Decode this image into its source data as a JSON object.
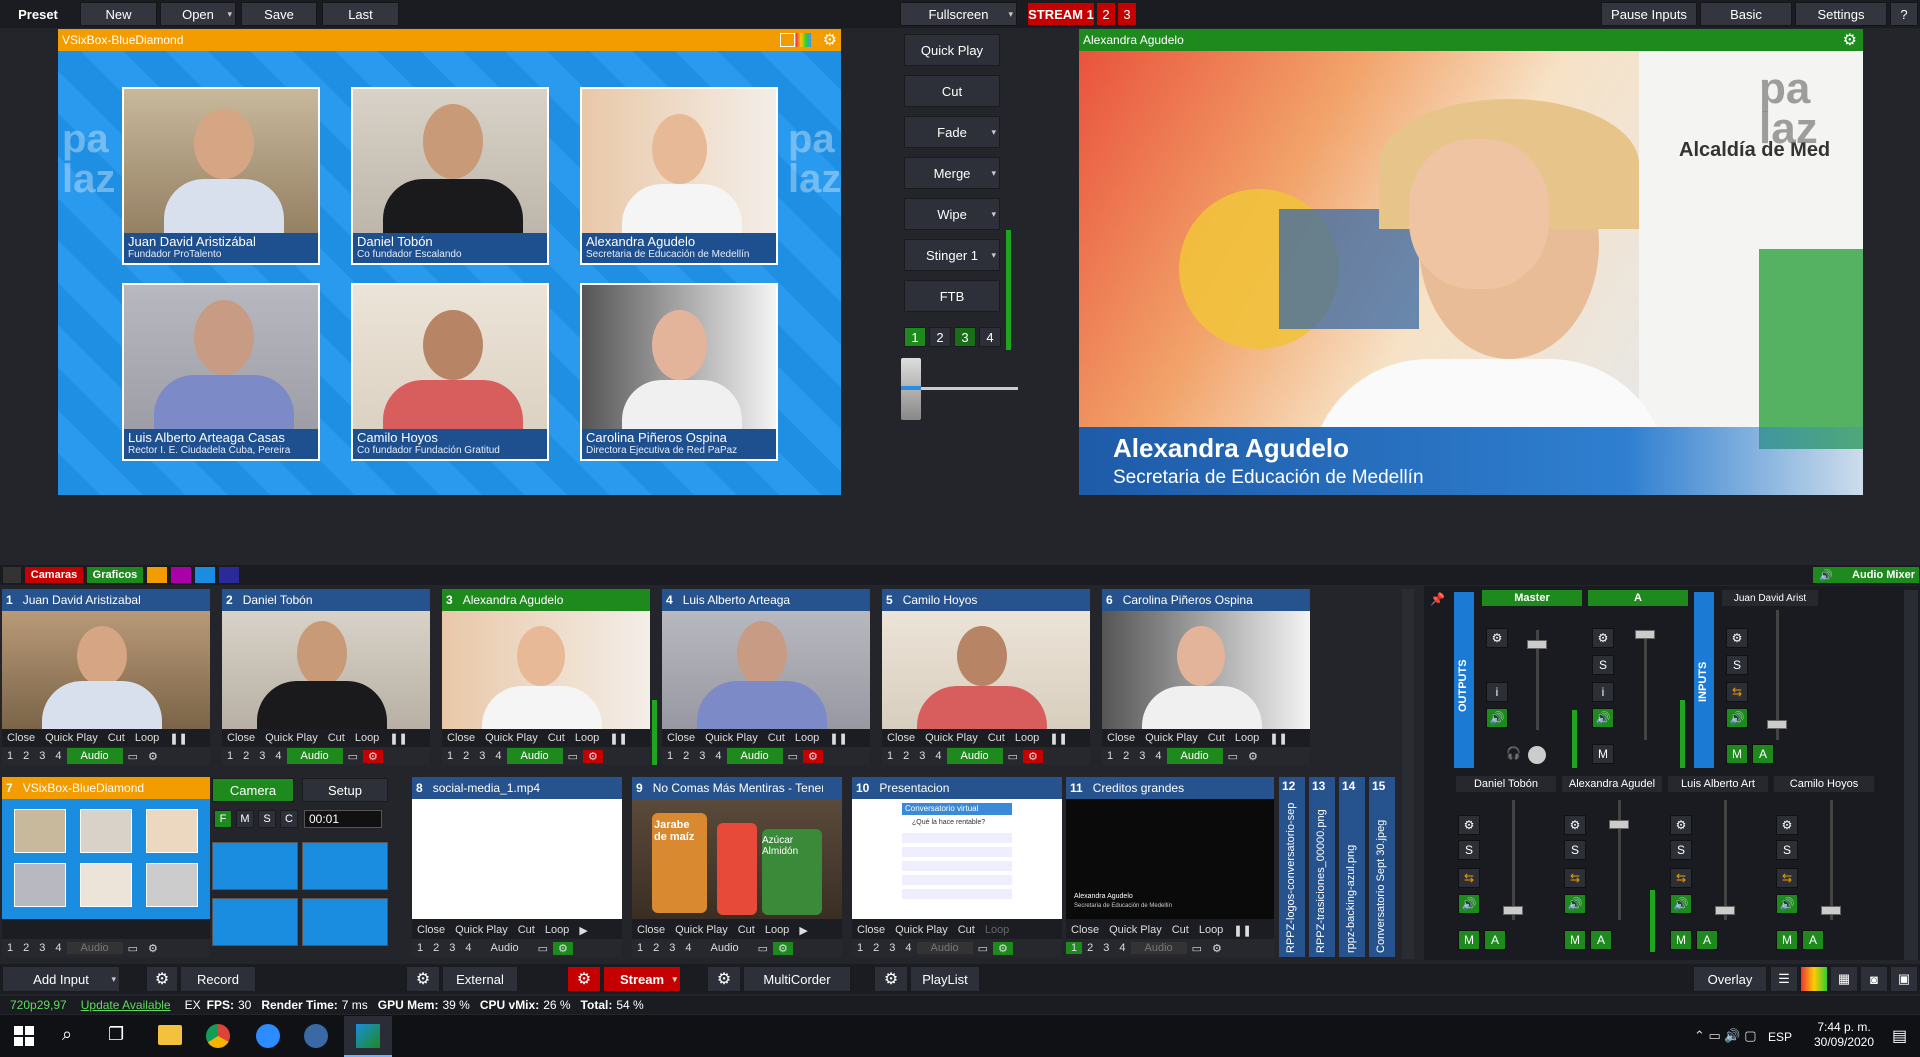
{
  "topbar": {
    "preset": "Preset",
    "new": "New",
    "open": "Open",
    "save": "Save",
    "last": "Last",
    "fullscreen": "Fullscreen",
    "stream1": "STREAM 1",
    "stream2": "2",
    "stream3": "3",
    "pause_inputs": "Pause Inputs",
    "basic": "Basic",
    "settings": "Settings",
    "help": "?"
  },
  "preview": {
    "title": "VSixBox-BlueDiamond",
    "tiles": [
      {
        "name": "Juan David Aristizábal",
        "role": "Fundador ProTalento"
      },
      {
        "name": "Daniel Tobón",
        "role": "Co fundador Escalando"
      },
      {
        "name": "Alexandra Agudelo",
        "role": "Secretaria de Educación de Medellín"
      },
      {
        "name": "Luis Alberto Arteaga Casas",
        "role": "Rector I. E. Ciudadela Cuba, Pereira"
      },
      {
        "name": "Camilo Hoyos",
        "role": "Co fundador Fundación Gratitud"
      },
      {
        "name": "Carolina Piñeros Ospina",
        "role": "Directora Ejecutiva de Red PaPaz"
      }
    ],
    "watermark": "pa laz"
  },
  "transitions": {
    "quick_play": "Quick Play",
    "cut": "Cut",
    "fade": "Fade",
    "merge": "Merge",
    "wipe": "Wipe",
    "stinger": "Stinger 1",
    "ftb": "FTB",
    "nums": [
      "1",
      "2",
      "3",
      "4"
    ]
  },
  "output": {
    "title": "Alexandra Agudelo",
    "lt_name": "Alexandra Agudelo",
    "lt_role": "Secretaria de Educación de Medellín",
    "sign": "Alcaldía de Med",
    "logo": "pa laz"
  },
  "tabs": {
    "camaras": "Camaras",
    "graficos": "Graficos",
    "audio_mixer": "Audio Mixer"
  },
  "inputs": [
    {
      "num": "1",
      "title": "Juan David Aristizabal"
    },
    {
      "num": "2",
      "title": "Daniel Tobón"
    },
    {
      "num": "3",
      "title": "Alexandra Agudelo"
    },
    {
      "num": "4",
      "title": "Luis Alberto Arteaga"
    },
    {
      "num": "5",
      "title": "Camilo Hoyos"
    },
    {
      "num": "6",
      "title": "Carolina Piñeros Ospina"
    }
  ],
  "row2": [
    {
      "num": "7",
      "title": "VSixBox-BlueDiamond"
    },
    {
      "num": "8",
      "title": "social-media_1.mp4"
    },
    {
      "num": "9",
      "title": "No Comas Más Mentiras - Tenemos D"
    },
    {
      "num": "10",
      "title": "Presentacion"
    },
    {
      "num": "11",
      "title": "Creditos grandes"
    }
  ],
  "card_controls": {
    "close": "Close",
    "quick_play": "Quick Play",
    "cut": "Cut",
    "loop": "Loop",
    "audio": "Audio",
    "n1": "1",
    "n2": "2",
    "n3": "3",
    "n4": "4"
  },
  "camera_panel": {
    "camera": "Camera",
    "setup": "Setup",
    "f": "F",
    "m": "M",
    "s": "S",
    "c": "C",
    "time": "00:01"
  },
  "narrow_inputs": [
    {
      "num": "12",
      "title": "RPPZ-logos-conversatorio-sept-"
    },
    {
      "num": "13",
      "title": "RPPZ-trasiciones_00000.png"
    },
    {
      "num": "14",
      "title": "rppz-backing-azul.png"
    },
    {
      "num": "15",
      "title": "Conversatorio Sept 30.jpeg"
    }
  ],
  "slide": {
    "header": "Conversatorio virtual",
    "q": "¿Qué la hace rentable?",
    "title": "Alexandra Agudelo",
    "subtitle": "Secretaria de Educación de Medellín"
  },
  "snack": {
    "l1": "Jarabe",
    "l2": "de maíz",
    "l3": "Azúcar",
    "l4": "Almidón"
  },
  "mixer": {
    "outputs": "OUTPUTS",
    "inputs": "INPUTS",
    "master": "Master",
    "a": "A",
    "juan": "Juan David Arist",
    "ch": [
      "Daniel Tobón",
      "Alexandra Agudel",
      "Luis Alberto Art",
      "Camilo Hoyos"
    ],
    "s": "S",
    "i": "i",
    "m": "M",
    "aa": "A"
  },
  "bottombar": {
    "add_input": "Add Input",
    "record": "Record",
    "external": "External",
    "stream": "Stream",
    "multicorder": "MultiCorder",
    "playlist": "PlayList",
    "overlay": "Overlay"
  },
  "status": {
    "format": "720p29,97",
    "update": "Update Available",
    "ex": "EX",
    "fps_label": "FPS:",
    "fps": "30",
    "render_label": "Render Time:",
    "render": "7 ms",
    "gpu_label": "GPU Mem:",
    "gpu": "39 %",
    "cpu_label": "CPU vMix:",
    "cpu": "26 %",
    "total_label": "Total:",
    "total": "54 %"
  },
  "taskbar": {
    "lang": "ESP",
    "time": "7:44 p. m.",
    "date": "30/09/2020"
  }
}
